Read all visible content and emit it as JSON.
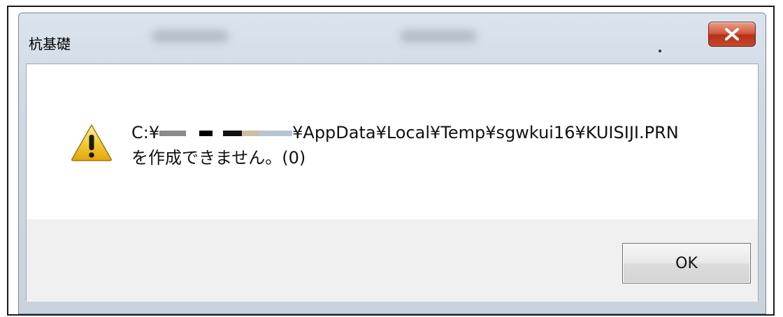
{
  "window": {
    "title": "杭基礎",
    "close_label": "x"
  },
  "message": {
    "path_prefix": "C:¥",
    "path_suffix": "¥AppData¥Local¥Temp¥sgwkui16¥KUISIJI.PRN",
    "line2": "を作成できません。(0)",
    "icon": "warning-icon"
  },
  "buttons": {
    "ok_label": "OK"
  },
  "colors": {
    "warning_yellow": "#f3c42c",
    "close_red": "#c8482c"
  }
}
